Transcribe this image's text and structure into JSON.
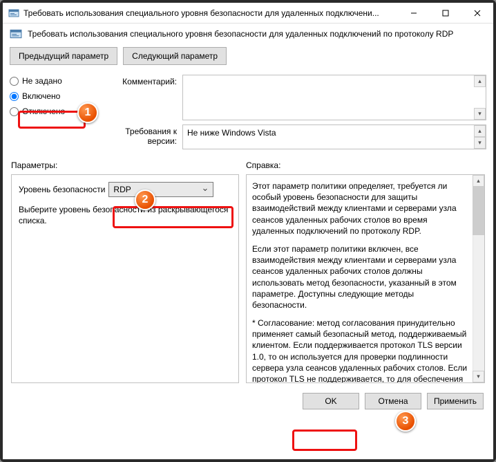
{
  "titlebar": {
    "title": "Требовать использования специального уровня безопасности для удаленных подключени..."
  },
  "header": {
    "label": "Требовать использования специального уровня безопасности для удаленных подключений по протоколу RDP"
  },
  "nav": {
    "prev": "Предыдущий параметр",
    "next": "Следующий параметр"
  },
  "radios": {
    "not_configured": "Не задано",
    "enabled": "Включено",
    "disabled": "Отключено"
  },
  "fields": {
    "comment_label": "Комментарий:",
    "supported_label": "Требования к версии:",
    "supported_value": "Не ниже Windows Vista"
  },
  "params": {
    "section_label": "Параметры:",
    "level_label": "Уровень безопасности",
    "level_value": "RDP",
    "hint": "Выберите уровень безопасности из раскрывающегося списка."
  },
  "help": {
    "section_label": "Справка:",
    "p1": "Этот параметр политики определяет, требуется ли особый уровень безопасности для защиты взаимодействий между клиентами и серверами узла сеансов удаленных рабочих столов во время удаленных подключений по протоколу RDP.",
    "p2": "Если этот параметр политики включен, все взаимодействия между клиентами и серверами узла сеансов удаленных рабочих столов должны использовать метод безопасности, указанный в этом параметре. Доступны следующие методы безопасности.",
    "p3": "* Согласование: метод согласования принудительно применяет самый безопасный метод, поддерживаемый клиентом. Если поддерживается протокол TLS версии 1.0, то он используется для проверки подлинности сервера узла сеансов удаленных рабочих столов. Если протокол TLS не поддерживается, то для обеспечения безопасности взаимодействий используется собственное шифрование протокола удаленного рабочего стола (RDP), но проверка"
  },
  "footer": {
    "ok": "OK",
    "cancel": "Отмена",
    "apply": "Применить"
  },
  "markers": {
    "m1": "1",
    "m2": "2",
    "m3": "3"
  }
}
